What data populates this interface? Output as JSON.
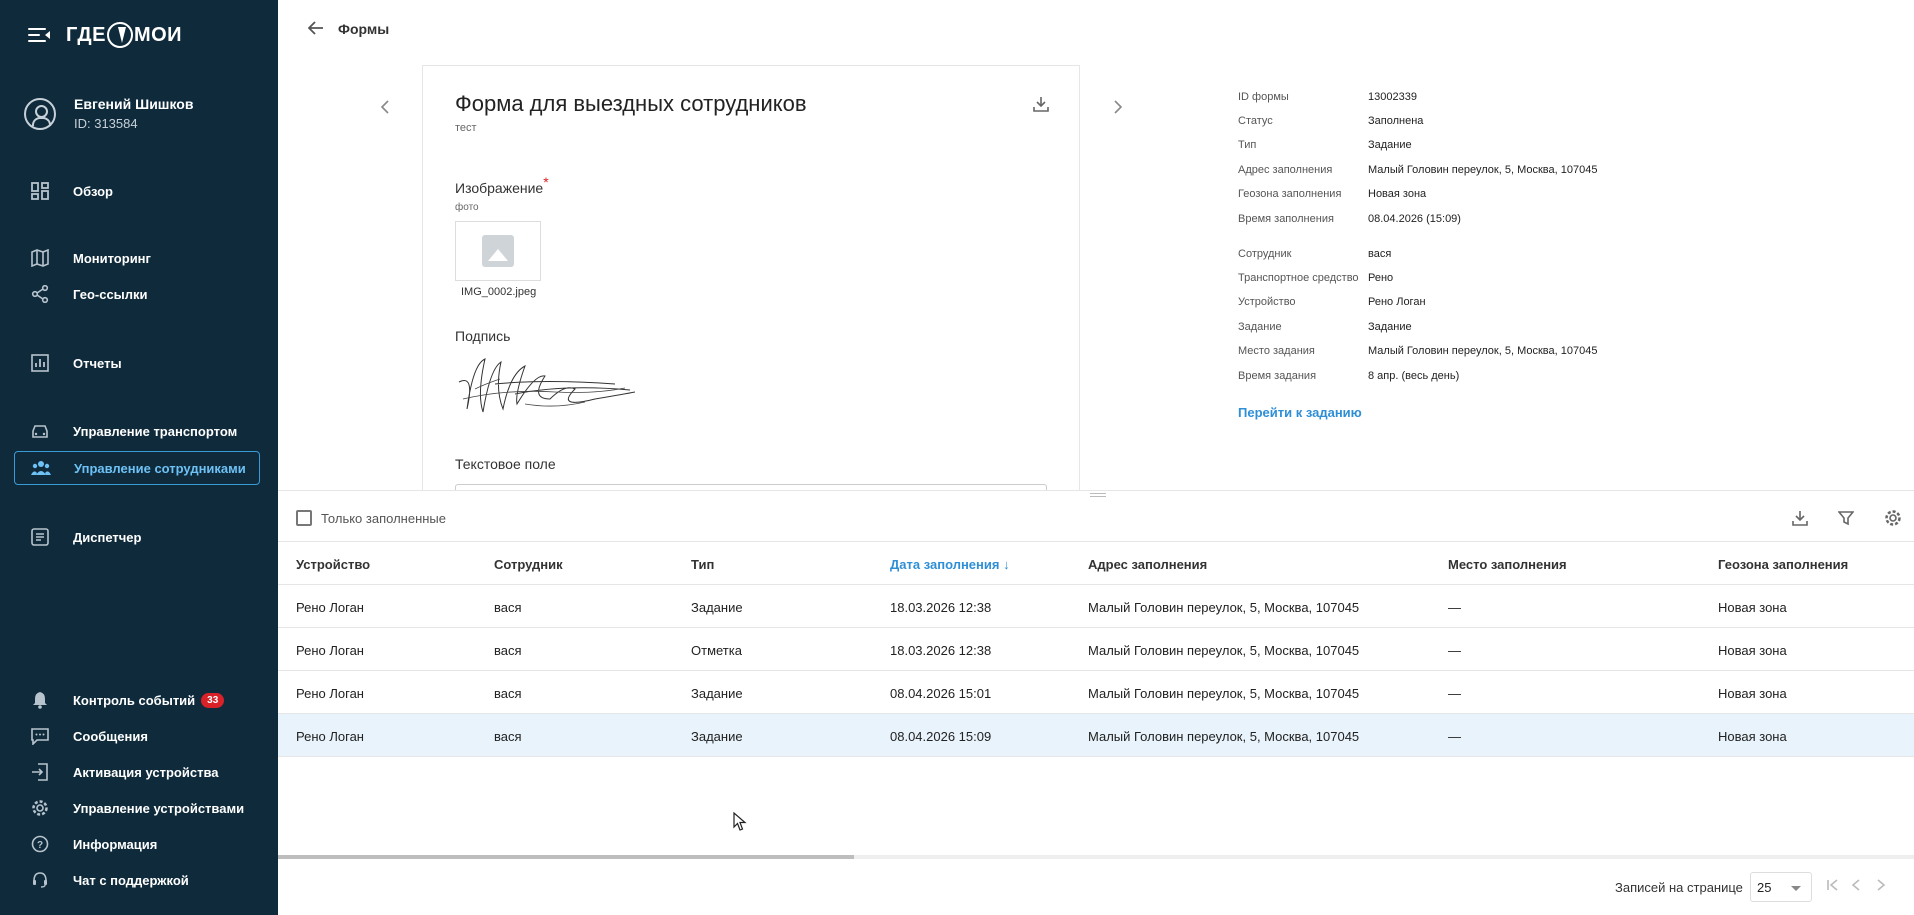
{
  "brand": {
    "logo_text_left": "ГДЕ",
    "logo_text_right": "МОИ"
  },
  "user": {
    "name": "Евгений Шишков",
    "id": "ID: 313584"
  },
  "nav": {
    "overview": "Обзор",
    "monitoring": "Мониторинг",
    "geolinks": "Гео-ссылки",
    "reports": "Отчеты",
    "transport": "Управление транспортом",
    "employees": "Управление сотрудниками",
    "dispatcher": "Диспетчер",
    "events": "Контроль событий",
    "events_badge": "33",
    "messages": "Сообщения",
    "activation": "Активация устройства",
    "devices": "Управление устройствами",
    "info": "Информация",
    "support": "Чат с поддержкой"
  },
  "header": {
    "title": "Формы"
  },
  "form": {
    "title": "Форма для выездных сотрудников",
    "subtitle": "тест",
    "image_label": "Изображение",
    "required_mark": "*",
    "image_hint": "фото",
    "image_file": "IMG_0002.jpeg",
    "signature_label": "Подпись",
    "text_field_label": "Текстовое поле"
  },
  "details": {
    "rows": [
      {
        "key": "ID формы",
        "value": "13002339"
      },
      {
        "key": "Статус",
        "value": "Заполнена"
      },
      {
        "key": "Тип",
        "value": "Задание"
      },
      {
        "key": "Адрес заполнения",
        "value": "Малый Головин переулок, 5, Москва, 107045"
      },
      {
        "key": "Геозона заполнения",
        "value": "Новая зона"
      },
      {
        "key": "Время заполнения",
        "value": "08.04.2026 (15:09)"
      },
      {
        "key": "Сотрудник",
        "value": "вася"
      },
      {
        "key": "Транспортное средство",
        "value": "Рено"
      },
      {
        "key": "Устройство",
        "value": "Рено Логан"
      },
      {
        "key": "Задание",
        "value": "Задание"
      },
      {
        "key": "Место задания",
        "value": "Малый Головин переулок, 5, Москва, 107045"
      },
      {
        "key": "Время задания",
        "value": "8 апр. (весь день)"
      }
    ],
    "link": "Перейти к заданию"
  },
  "filter": {
    "only_filled": "Только заполненные"
  },
  "table": {
    "columns": [
      "Устройство",
      "Сотрудник",
      "Тип",
      "Дата заполнения",
      "Адрес заполнения",
      "Место заполнения",
      "Геозона заполнения"
    ],
    "sorted_column_index": 3,
    "sort_arrow": "↓",
    "rows": [
      [
        "Рено Логан",
        "вася",
        "Задание",
        "18.03.2026 12:38",
        "Малый Головин переулок, 5, Москва, 107045",
        "—",
        "Новая зона"
      ],
      [
        "Рено Логан",
        "вася",
        "Отметка",
        "18.03.2026 12:38",
        "Малый Головин переулок, 5, Москва, 107045",
        "—",
        "Новая зона"
      ],
      [
        "Рено Логан",
        "вася",
        "Задание",
        "08.04.2026 15:01",
        "Малый Головин переулок, 5, Москва, 107045",
        "—",
        "Новая зона"
      ],
      [
        "Рено Логан",
        "вася",
        "Задание",
        "08.04.2026 15:09",
        "Малый Головин переулок, 5, Москва, 107045",
        "—",
        "Новая зона"
      ]
    ],
    "selected_row_index": 3
  },
  "pagination": {
    "label": "Записей на странице",
    "per_page": "25"
  },
  "colors": {
    "sidebar_bg": "#0e2a3b",
    "accent": "#2f8fd6",
    "selected_row": "#e8f3fb",
    "badge": "#d92128"
  }
}
